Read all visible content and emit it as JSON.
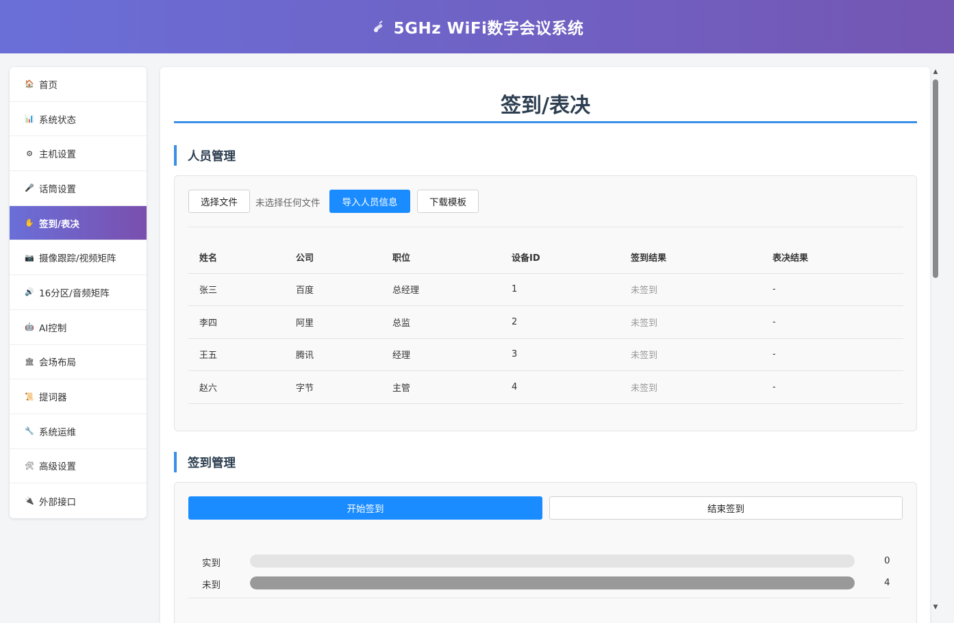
{
  "app": {
    "title": "5GHz WiFi数字会议系统",
    "logo_icon": "satellite-icon"
  },
  "sidebar": {
    "items": [
      {
        "label": "首页",
        "icon": "home-icon",
        "active": false
      },
      {
        "label": "系统状态",
        "icon": "bar-chart-icon",
        "active": false
      },
      {
        "label": "主机设置",
        "icon": "gear-icon",
        "active": false
      },
      {
        "label": "话筒设置",
        "icon": "microphone-icon",
        "active": false
      },
      {
        "label": "签到/表决",
        "icon": "raised-hand-icon",
        "active": true
      },
      {
        "label": "摄像跟踪/视频矩阵",
        "icon": "camera-icon",
        "active": false
      },
      {
        "label": "16分区/音频矩阵",
        "icon": "speaker-icon",
        "active": false
      },
      {
        "label": "AI控制",
        "icon": "robot-icon",
        "active": false
      },
      {
        "label": "会场布局",
        "icon": "building-icon",
        "active": false
      },
      {
        "label": "提词器",
        "icon": "scroll-icon",
        "active": false
      },
      {
        "label": "系统运维",
        "icon": "wrench-icon",
        "active": false
      },
      {
        "label": "高级设置",
        "icon": "tools-icon",
        "active": false
      },
      {
        "label": "外部接口",
        "icon": "plug-icon",
        "active": false
      }
    ]
  },
  "main": {
    "title": "签到/表决",
    "personnel": {
      "title": "人员管理",
      "choose_file": "选择文件",
      "file_status": "未选择任何文件",
      "import_button": "导入人员信息",
      "download_button": "下载模板",
      "columns": [
        "姓名",
        "公司",
        "职位",
        "设备ID",
        "签到结果",
        "表决结果"
      ],
      "rows": [
        [
          "张三",
          "百度",
          "总经理",
          "1",
          "未签到",
          "-"
        ],
        [
          "李四",
          "阿里",
          "总监",
          "2",
          "未签到",
          "-"
        ],
        [
          "王五",
          "腾讯",
          "经理",
          "3",
          "未签到",
          "-"
        ],
        [
          "赵六",
          "字节",
          "主管",
          "4",
          "未签到",
          "-"
        ]
      ]
    },
    "signin": {
      "title": "签到管理",
      "start_button": "开始签到",
      "end_button": "结束签到",
      "stats": [
        {
          "label": "实到",
          "value": "0",
          "fraction": 0
        },
        {
          "label": "未到",
          "value": "4",
          "fraction": 1
        }
      ]
    }
  },
  "colors": {
    "accent": "#1a8cff",
    "header_start": "#6a6fd8",
    "header_end": "#7456b3",
    "section_bar": "#3a8ee6"
  }
}
